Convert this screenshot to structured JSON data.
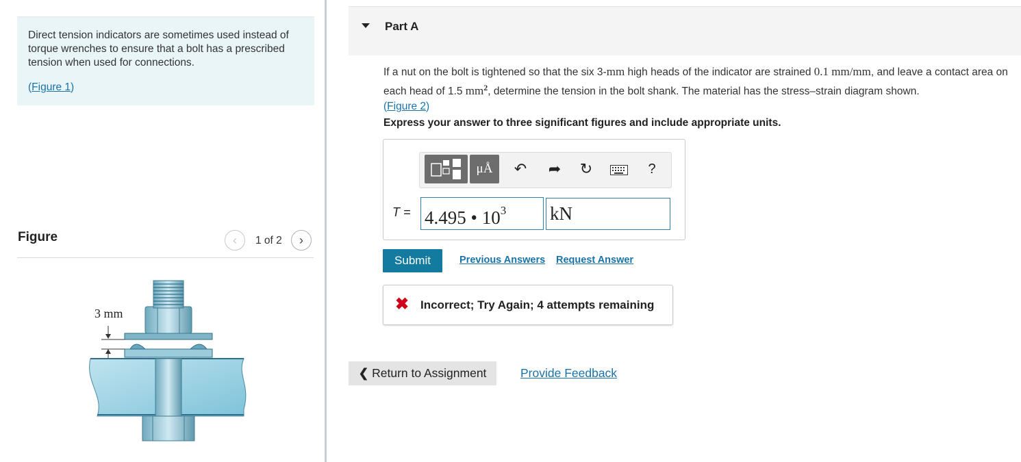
{
  "intro": {
    "text": "Direct tension indicators are sometimes used instead of torque wrenches to ensure that a bolt has a prescribed tension when used for connections.",
    "figure_link": "Figure 1"
  },
  "figure_panel": {
    "title": "Figure",
    "pager": "1 of 2",
    "dimension_label": "3 mm"
  },
  "part": {
    "title": "Part A",
    "question": {
      "t1": "If a nut on the bolt is tightened so that the six 3-",
      "m1": "mm",
      "t2": " high heads of the indicator are strained ",
      "m2": "0.1 mm/mm",
      "t3": ", and leave a contact area on each head of 1.5 ",
      "m3": "mm",
      "sup": "2",
      "t4": ", determine the tension in the bolt shank. The material has the stress–strain diagram shown.",
      "figure_link": "Figure 2"
    },
    "instruction": "Express your answer to three significant figures and include appropriate units."
  },
  "answer": {
    "variable_label": "T =",
    "value_mantissa": "4.495 • 10",
    "value_exponent": "3",
    "unit": "kN",
    "units_tool": "μÅ",
    "help_tool": "?"
  },
  "actions": {
    "submit": "Submit",
    "previous_answers": "Previous Answers",
    "request_answer": "Request Answer"
  },
  "feedback": {
    "icon": "✖",
    "text": "Incorrect; Try Again; 4 attempts remaining"
  },
  "footer": {
    "return_label": "Return to Assignment",
    "provide_feedback": "Provide Feedback"
  },
  "colors": {
    "accent": "#137aa0",
    "link": "#1a73a8",
    "error": "#d0021b",
    "intro_bg": "#e9f5f7"
  }
}
